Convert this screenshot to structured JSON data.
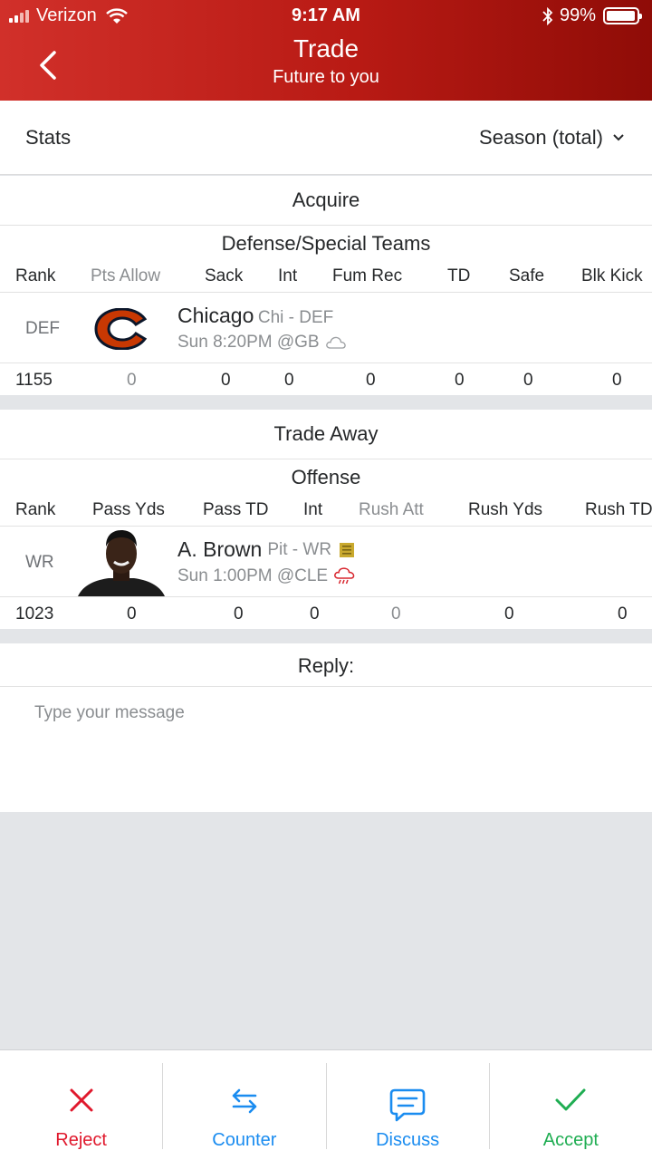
{
  "status_bar": {
    "carrier": "Verizon",
    "time": "9:17 AM",
    "battery": "99%"
  },
  "header": {
    "title": "Trade",
    "subtitle": "Future to you"
  },
  "stats": {
    "label": "Stats",
    "period": "Season (total)"
  },
  "acquire": {
    "section_title": "Acquire",
    "group_title": "Defense/Special Teams",
    "columns": [
      "Rank",
      "Pts Allow",
      "Sack",
      "Int",
      "Fum Rec",
      "TD",
      "Safe",
      "Blk Kick"
    ],
    "player": {
      "position": "DEF",
      "name": "Chicago",
      "team": "Chi - DEF",
      "game": "Sun 8:20PM @GB"
    },
    "values": [
      "1155",
      "0",
      "0",
      "0",
      "0",
      "0",
      "0",
      "0"
    ]
  },
  "trade_away": {
    "section_title": "Trade Away",
    "group_title": "Offense",
    "columns": [
      "Rank",
      "Pass Yds",
      "Pass TD",
      "Int",
      "Rush Att",
      "Rush Yds",
      "Rush TD"
    ],
    "player": {
      "position": "WR",
      "name": "A. Brown",
      "team": "Pit - WR",
      "game": "Sun 1:00PM @CLE"
    },
    "values": [
      "1023",
      "0",
      "0",
      "0",
      "0",
      "0",
      "0"
    ]
  },
  "reply": {
    "title": "Reply:",
    "placeholder": "Type your message",
    "value": ""
  },
  "actions": {
    "reject": "Reject",
    "counter": "Counter",
    "discuss": "Discuss",
    "accept": "Accept"
  },
  "colors": {
    "header_start": "#d1302a",
    "header_end": "#8f0c07",
    "reject": "#e0192d",
    "counter": "#1a8cf0",
    "discuss": "#1a8cf0",
    "accept": "#1fad52"
  }
}
